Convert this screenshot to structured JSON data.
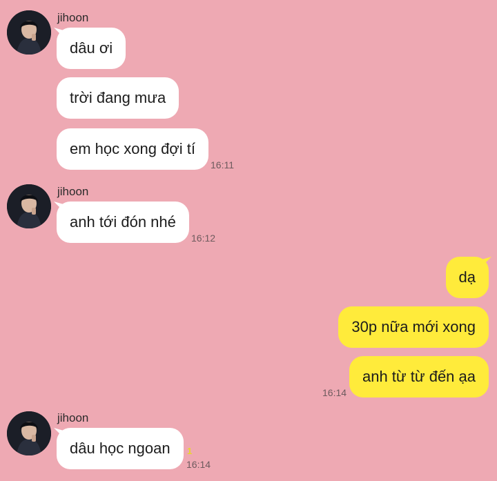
{
  "theme": {
    "background": "#eea9b3",
    "incoming_bubble": "#ffffff",
    "outgoing_bubble": "#ffeb3b",
    "unread_color": "#e8d62a"
  },
  "groups": [
    {
      "sender": "jihoon",
      "avatar_icon": "profile-photo",
      "messages": [
        "dâu ơi",
        "trời đang mưa",
        "em học xong đợi tí"
      ],
      "time": "16:11"
    },
    {
      "sender": "jihoon",
      "avatar_icon": "profile-photo",
      "messages": [
        "anh tới đón nhé"
      ],
      "time": "16:12"
    },
    {
      "sender": "me",
      "messages": [
        "dạ",
        "30p nữa mới xong",
        "anh từ từ đến ạa"
      ],
      "time": "16:14"
    },
    {
      "sender": "jihoon",
      "avatar_icon": "profile-photo",
      "messages": [
        "dâu học ngoan"
      ],
      "unread": "1",
      "time": "16:14"
    }
  ]
}
